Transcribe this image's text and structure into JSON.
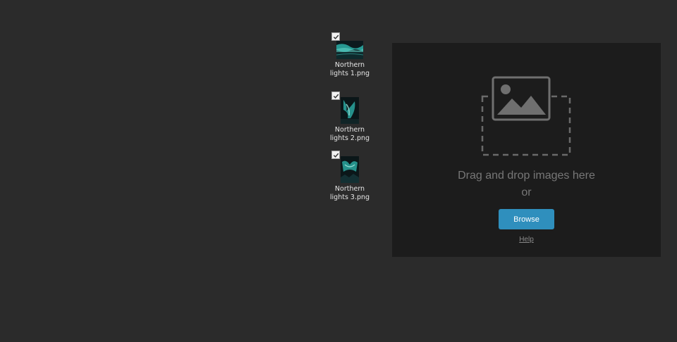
{
  "desktop": {
    "files": [
      {
        "name": "Northern lights 1.png",
        "checked": true,
        "orientation": "landscape",
        "icon": "image-thumbnail-icon"
      },
      {
        "name": "Northern lights 2.png",
        "checked": true,
        "orientation": "portrait",
        "icon": "image-thumbnail-icon"
      },
      {
        "name": "Northern lights 3.png",
        "checked": true,
        "orientation": "portrait",
        "icon": "image-thumbnail-icon"
      }
    ]
  },
  "dropzone": {
    "title": "Drag and drop images here",
    "or_text": "or",
    "browse_label": "Browse",
    "help_label": "Help",
    "icon": "image-placeholder-icon"
  },
  "colors": {
    "background": "#2b2b2b",
    "dropzone_bg": "#1c1c1c",
    "accent": "#2f8fbd",
    "muted_text": "#777777",
    "thumbnail_teal": "#2aa7a0"
  }
}
